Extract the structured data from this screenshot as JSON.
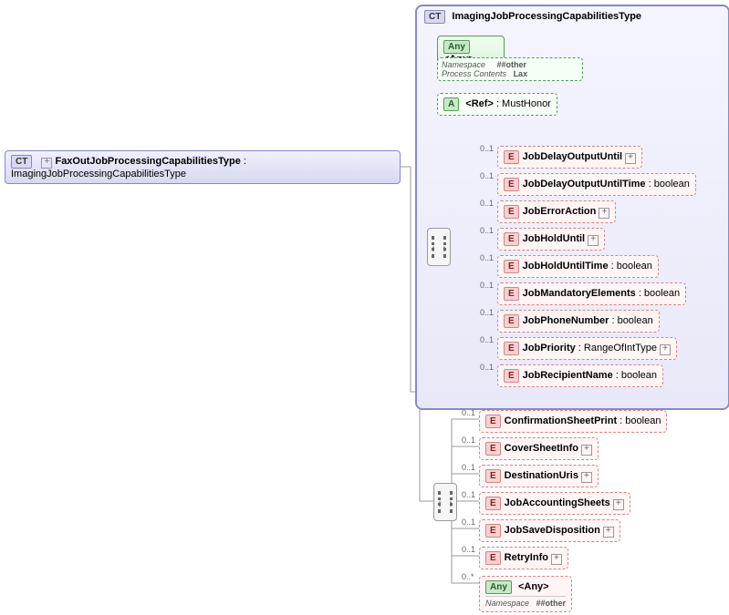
{
  "root": {
    "badge": "CT",
    "name": "FaxOutJobProcessingCapabilitiesType",
    "extends": "ImagingJobProcessingCapabilitiesType"
  },
  "parent": {
    "badge": "CT",
    "name": "ImagingJobProcessingCapabilitiesType"
  },
  "any_top": {
    "badge": "Any",
    "label": "<Any>",
    "rows": [
      {
        "k": "Namespace",
        "v": "##other"
      },
      {
        "k": "Process Contents",
        "v": "Lax"
      }
    ]
  },
  "ref": {
    "badge": "A",
    "label": "<Ref>",
    "type": ": MustHonor"
  },
  "card01": "0..1",
  "card0star": "0..*",
  "inherited": [
    {
      "badge": "E",
      "name": "JobDelayOutputUntil",
      "type": "",
      "plus": true
    },
    {
      "badge": "E",
      "name": "JobDelayOutputUntilTime",
      "type": " : boolean",
      "plus": false
    },
    {
      "badge": "E",
      "name": "JobErrorAction",
      "type": "",
      "plus": true
    },
    {
      "badge": "E",
      "name": "JobHoldUntil",
      "type": "",
      "plus": true
    },
    {
      "badge": "E",
      "name": "JobHoldUntilTime",
      "type": " : boolean",
      "plus": false
    },
    {
      "badge": "E",
      "name": "JobMandatoryElements",
      "type": " : boolean",
      "plus": false
    },
    {
      "badge": "E",
      "name": "JobPhoneNumber",
      "type": " : boolean",
      "plus": false
    },
    {
      "badge": "E",
      "name": "JobPriority",
      "type": " : RangeOfIntType",
      "plus": true
    },
    {
      "badge": "E",
      "name": "JobRecipientName",
      "type": " : boolean",
      "plus": false
    }
  ],
  "own": [
    {
      "badge": "E",
      "name": "ConfirmationSheetPrint",
      "type": " : boolean",
      "plus": false
    },
    {
      "badge": "E",
      "name": "CoverSheetInfo",
      "type": "",
      "plus": true
    },
    {
      "badge": "E",
      "name": "DestinationUris",
      "type": "",
      "plus": true
    },
    {
      "badge": "E",
      "name": "JobAccountingSheets",
      "type": "",
      "plus": true
    },
    {
      "badge": "E",
      "name": "JobSaveDisposition",
      "type": "",
      "plus": true
    },
    {
      "badge": "E",
      "name": "RetryInfo",
      "type": "",
      "plus": true
    }
  ],
  "any_bottom": {
    "badge": "Any",
    "label": "<Any>",
    "rows": [
      {
        "k": "Namespace",
        "v": "##other"
      }
    ]
  }
}
